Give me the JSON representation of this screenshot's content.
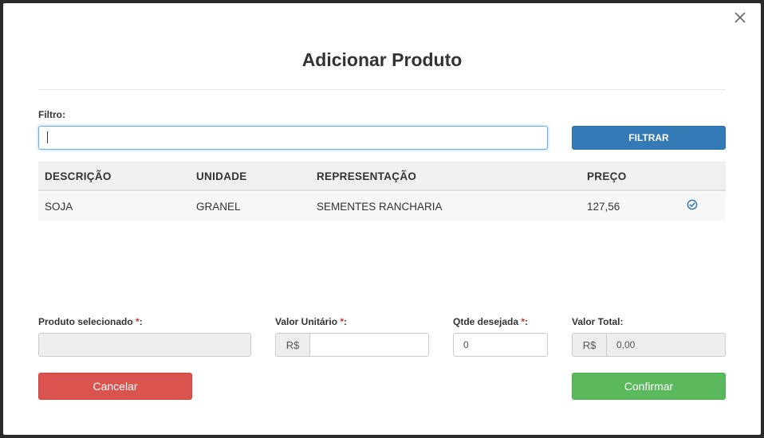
{
  "modal": {
    "title": "Adicionar Produto",
    "close_icon": "close-icon"
  },
  "filter": {
    "label": "Filtro:",
    "value": "",
    "button_label": "FILTRAR"
  },
  "table": {
    "headers": [
      "DESCRIÇÃO",
      "UNIDADE",
      "REPRESENTAÇÃO",
      "PREÇO"
    ],
    "rows": [
      {
        "descricao": "SOJA",
        "unidade": "GRANEL",
        "representacao": "SEMENTES RANCHARIA",
        "preco": "127,56",
        "action_icon": "check-circle-icon"
      }
    ]
  },
  "form": {
    "produto_label": "Produto selecionado",
    "produto_value": "",
    "valor_unitario_label": "Valor Unitário",
    "valor_unitario_prefix": "R$",
    "valor_unitario_value": "",
    "qtde_label": "Qtde desejada",
    "qtde_value": "0",
    "valor_total_label": "Valor Total:",
    "valor_total_prefix": "R$",
    "valor_total_value": "0,00",
    "required_mark": "*",
    "label_suffix": ":"
  },
  "actions": {
    "cancel_label": "Cancelar",
    "confirm_label": "Confirmar"
  },
  "colors": {
    "primary": "#337ab7",
    "danger": "#d9534f",
    "success": "#5cb85c",
    "required": "#d9302c"
  }
}
